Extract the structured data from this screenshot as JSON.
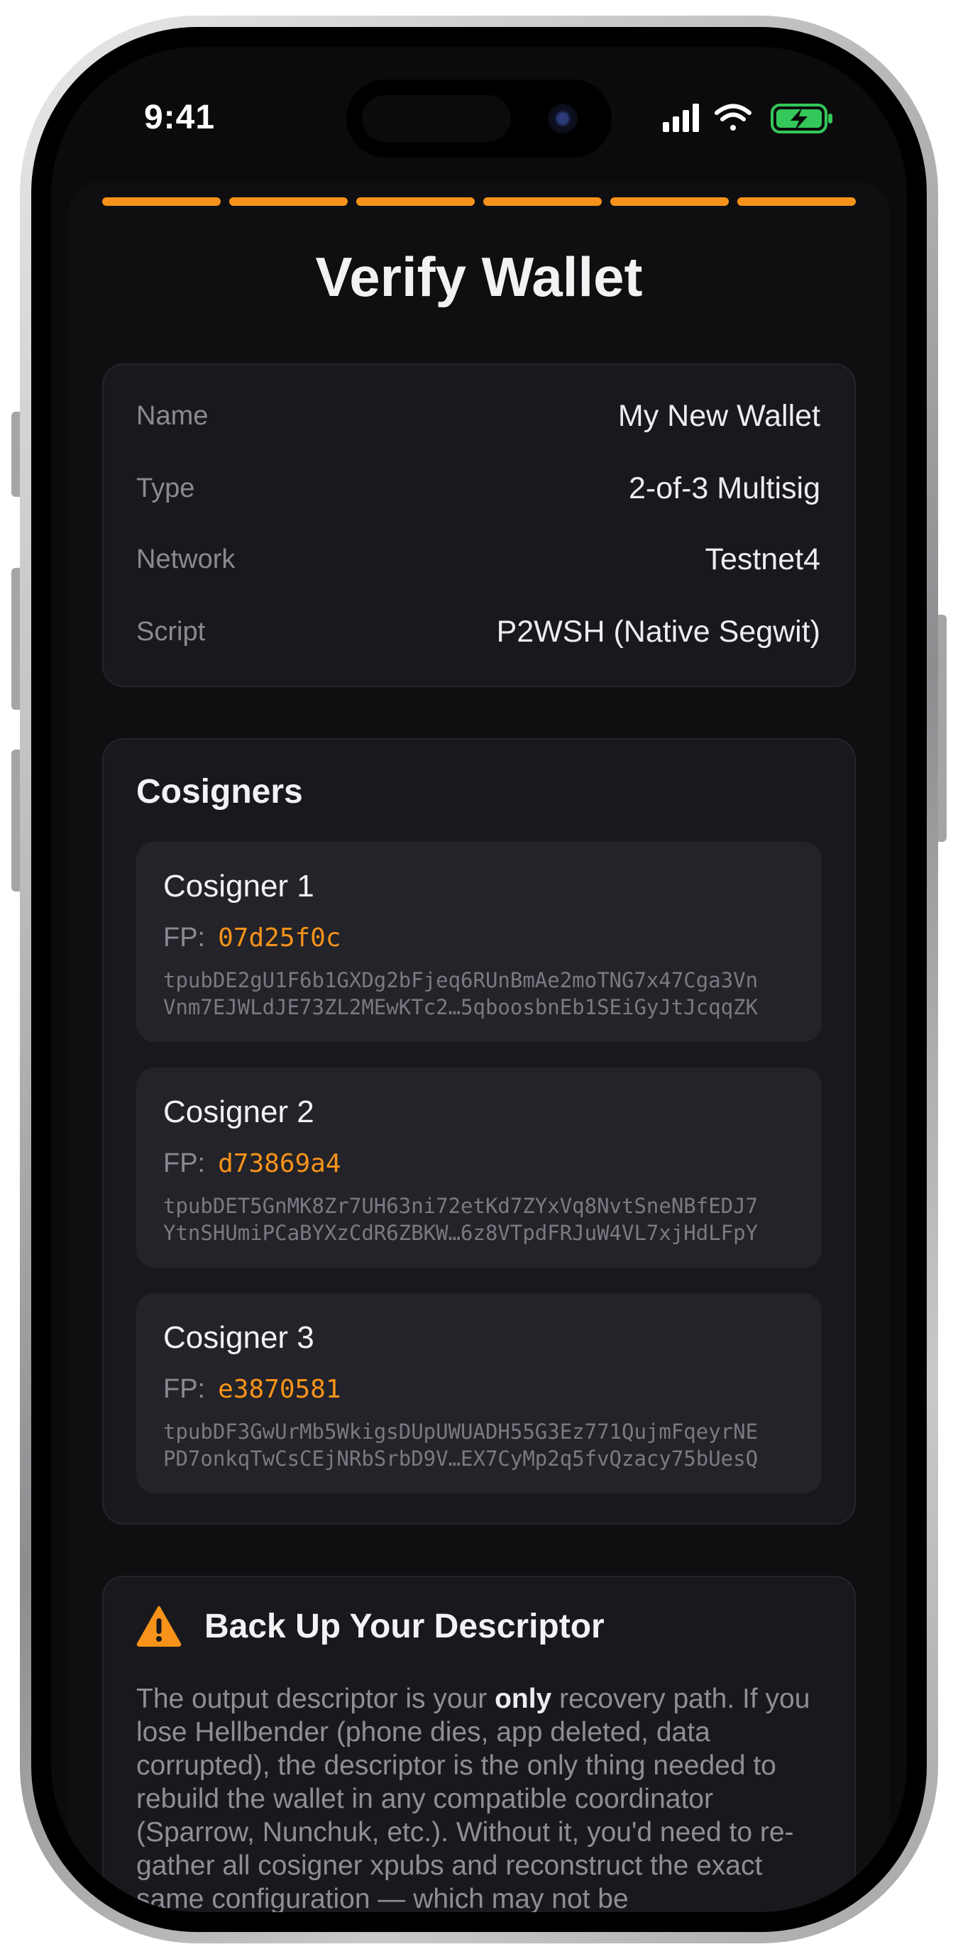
{
  "status_bar": {
    "time": "9:41"
  },
  "progress": {
    "steps": 6,
    "completed": 6,
    "color": "#f7931a"
  },
  "page": {
    "title": "Verify Wallet"
  },
  "wallet_info": [
    {
      "label": "Name",
      "value": "My New Wallet"
    },
    {
      "label": "Type",
      "value": "2-of-3 Multisig"
    },
    {
      "label": "Network",
      "value": "Testnet4"
    },
    {
      "label": "Script",
      "value": "P2WSH (Native Segwit)"
    }
  ],
  "cosigners": {
    "title": "Cosigners",
    "fp_label": "FP:",
    "items": [
      {
        "name": "Cosigner 1",
        "fp": "07d25f0c",
        "xpub_line1": "tpubDE2gU1F6b1GXDg2bFjeq6RUnBmAe2moTNG7x47Cga3Vn",
        "xpub_line2": "Vnm7EJWLdJE73ZL2MEwKTc2…5qboosbnEb1SEiGyJtJcqqZK"
      },
      {
        "name": "Cosigner 2",
        "fp": "d73869a4",
        "xpub_line1": "tpubDET5GnMK8Zr7UH63ni72etKd7ZYxVq8NvtSneNBfEDJ7",
        "xpub_line2": "YtnSHUmiPCaBYXzCdR6ZBKW…6z8VTpdFRJuW4VL7xjHdLFpY"
      },
      {
        "name": "Cosigner 3",
        "fp": "e3870581",
        "xpub_line1": "tpubDF3GwUrMb5WkigsDUpUWUADH55G3Ez771QujmFqeyrNE",
        "xpub_line2": "PD7onkqTwCsCEjNRbSrbD9V…EX7CyMp2q5fvQzacy75bUesQ"
      }
    ]
  },
  "backup": {
    "title": "Back Up Your Descriptor",
    "body_before": "The output descriptor is your ",
    "body_emphasis": "only",
    "body_after": " recovery path. If you lose Hellbender (phone dies, app deleted, data corrupted), the descriptor is the only thing needed to rebuild the wallet in any compatible coordinator (Sparrow, Nunchuk, etc.). Without it, you'd need to re-gather all cosigner xpubs and reconstruct the exact same configuration — which may not be"
  },
  "colors": {
    "accent": "#f7931a",
    "background": "#0f0f12",
    "card": "#19191d",
    "battery": "#34c759"
  }
}
